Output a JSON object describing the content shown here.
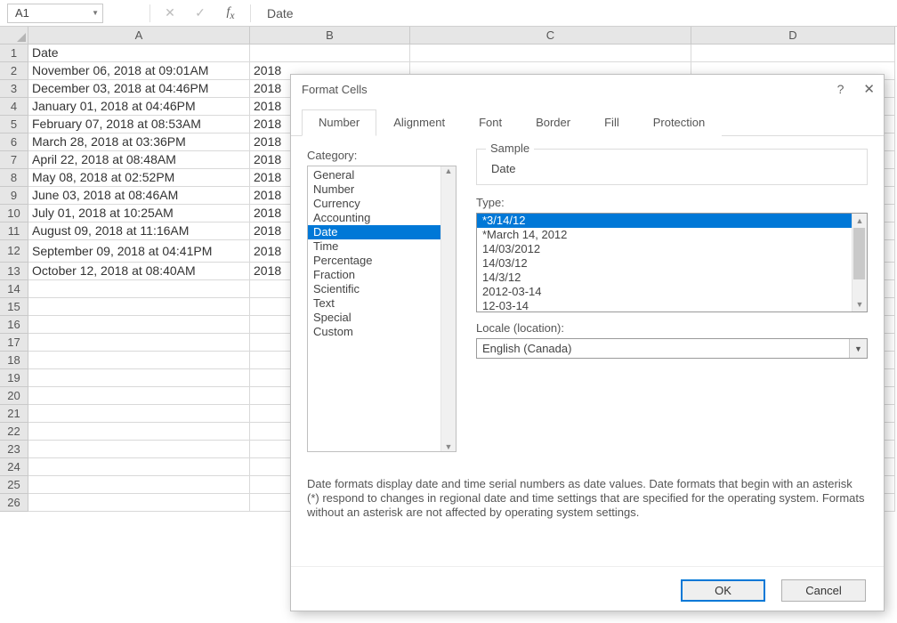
{
  "formula_bar": {
    "name_box": "A1",
    "value": "Date"
  },
  "columns": [
    "A",
    "B",
    "C",
    "D"
  ],
  "rows": [
    {
      "n": "1",
      "a": "Date",
      "b": ""
    },
    {
      "n": "2",
      "a": "November 06, 2018 at 09:01AM",
      "b": "2018"
    },
    {
      "n": "3",
      "a": "December 03, 2018 at 04:46PM",
      "b": "2018"
    },
    {
      "n": "4",
      "a": "January 01, 2018 at 04:46PM",
      "b": "2018"
    },
    {
      "n": "5",
      "a": "February 07, 2018 at 08:53AM",
      "b": "2018"
    },
    {
      "n": "6",
      "a": "March 28, 2018 at 03:36PM",
      "b": "2018"
    },
    {
      "n": "7",
      "a": "April 22, 2018 at 08:48AM",
      "b": "2018"
    },
    {
      "n": "8",
      "a": "May 08, 2018 at 02:52PM",
      "b": "2018"
    },
    {
      "n": "9",
      "a": "June 03, 2018 at 08:46AM",
      "b": "2018"
    },
    {
      "n": "10",
      "a": "July 01, 2018 at 10:25AM",
      "b": "2018"
    },
    {
      "n": "11",
      "a": "August 09, 2018 at 11:16AM",
      "b": "2018"
    },
    {
      "n": "12",
      "a": "September 09, 2018 at 04:41PM",
      "b": "2018",
      "tall": true
    },
    {
      "n": "13",
      "a": "October 12, 2018 at 08:40AM",
      "b": "2018"
    },
    {
      "n": "14",
      "a": "",
      "b": ""
    },
    {
      "n": "15",
      "a": "",
      "b": ""
    },
    {
      "n": "16",
      "a": "",
      "b": ""
    },
    {
      "n": "17",
      "a": "",
      "b": ""
    },
    {
      "n": "18",
      "a": "",
      "b": ""
    },
    {
      "n": "19",
      "a": "",
      "b": ""
    },
    {
      "n": "20",
      "a": "",
      "b": ""
    },
    {
      "n": "21",
      "a": "",
      "b": ""
    },
    {
      "n": "22",
      "a": "",
      "b": ""
    },
    {
      "n": "23",
      "a": "",
      "b": ""
    },
    {
      "n": "24",
      "a": "",
      "b": ""
    },
    {
      "n": "25",
      "a": "",
      "b": ""
    },
    {
      "n": "26",
      "a": "",
      "b": ""
    }
  ],
  "dialog": {
    "title": "Format Cells",
    "tabs": [
      "Number",
      "Alignment",
      "Font",
      "Border",
      "Fill",
      "Protection"
    ],
    "active_tab": 0,
    "category_label": "Category:",
    "categories": [
      "General",
      "Number",
      "Currency",
      "Accounting",
      "Date",
      "Time",
      "Percentage",
      "Fraction",
      "Scientific",
      "Text",
      "Special",
      "Custom"
    ],
    "selected_category": "Date",
    "sample_label": "Sample",
    "sample_value": "Date",
    "type_label": "Type:",
    "types": [
      "*3/14/12",
      "*March 14, 2012",
      "14/03/2012",
      "14/03/12",
      "14/3/12",
      "2012-03-14",
      "12-03-14"
    ],
    "selected_type": "*3/14/12",
    "locale_label": "Locale (location):",
    "locale_value": "English (Canada)",
    "description": "Date formats display date and time serial numbers as date values.  Date formats that begin with an asterisk (*) respond to changes in regional date and time settings that are specified for the operating system. Formats without an asterisk are not affected by operating system settings.",
    "ok": "OK",
    "cancel": "Cancel"
  }
}
